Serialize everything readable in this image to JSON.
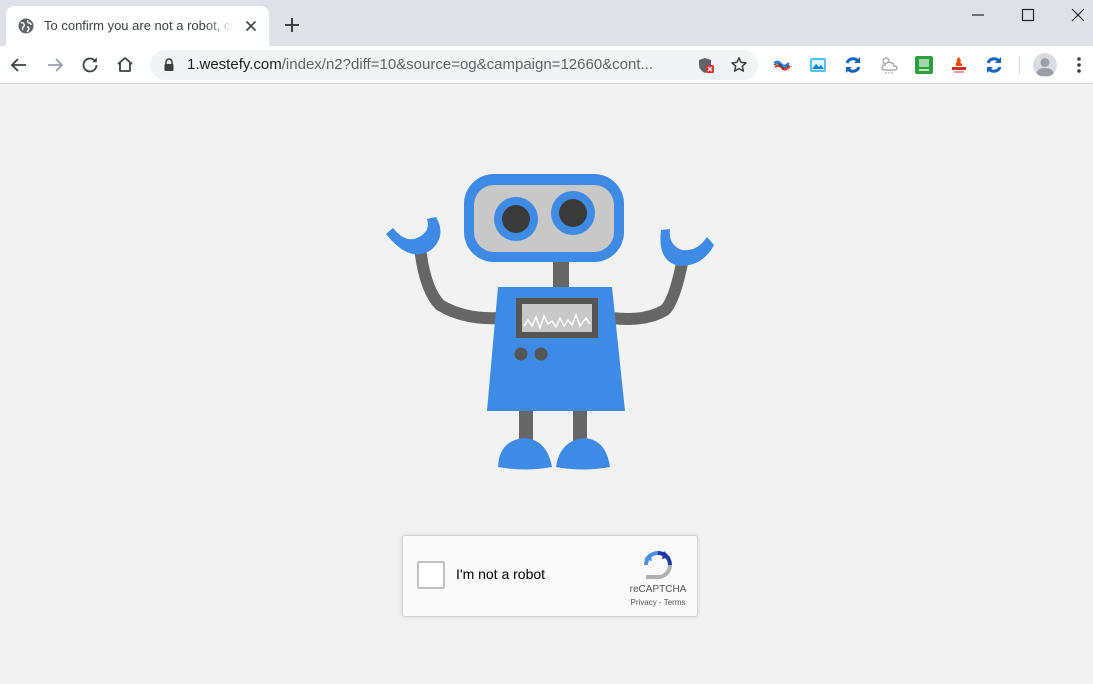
{
  "browser": {
    "tab": {
      "title": "To confirm you are not a robot, click Allow",
      "favicon": "globe-icon"
    },
    "window_controls": [
      "minimize-icon",
      "maximize-icon",
      "close-icon"
    ],
    "address_bar": {
      "host": "1.westefy.com",
      "path": "/index/n2?diff=10&source=og&campaign=12660&cont..."
    },
    "extensions": [
      "slideshow-extension-icon",
      "image-extension-icon",
      "sync-extension-icon",
      "weather-extension-icon",
      "green-extension-icon",
      "red-extension-icon",
      "sync-extension-icon-2"
    ]
  },
  "page": {
    "robot_image": "blue-robot-illustration",
    "recaptcha": {
      "checkbox_label": "I'm not a robot",
      "brand": "reCAPTCHA",
      "links": "Privacy - Terms"
    }
  },
  "colors": {
    "robot_blue": "#3d8be5",
    "robot_gray": "#666666",
    "page_background": "#f2f2f2"
  }
}
